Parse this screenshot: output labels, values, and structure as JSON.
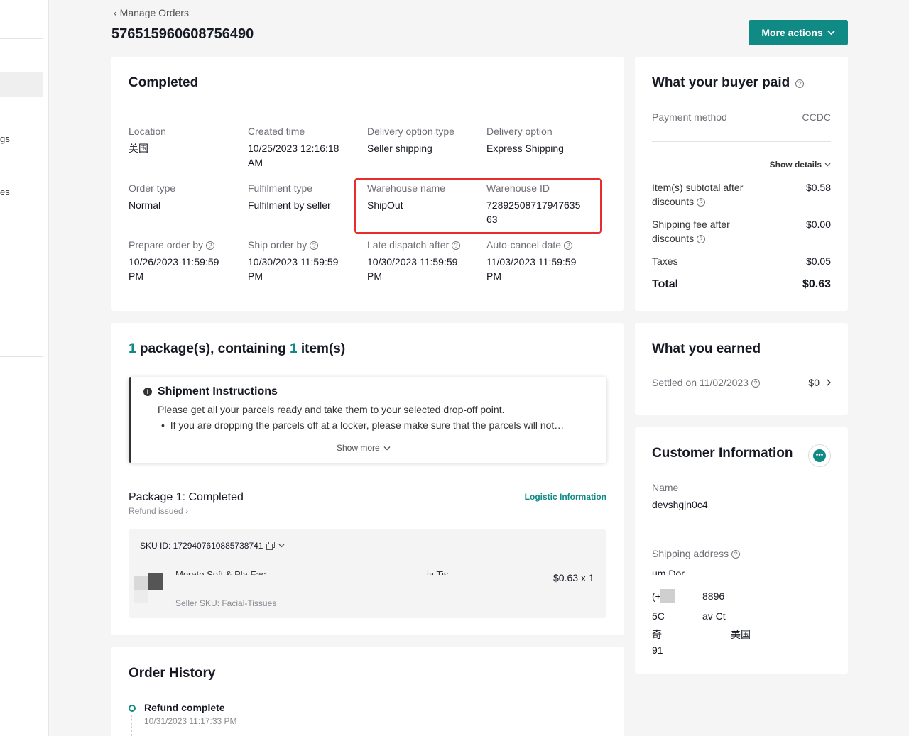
{
  "sidebar": {
    "item1": "gs",
    "item2": "es"
  },
  "header": {
    "back_label": "Manage Orders",
    "order_id": "576515960608756490",
    "more_actions": "More actions"
  },
  "status": {
    "title": "Completed",
    "fields": [
      {
        "label": "Location",
        "value": "美国"
      },
      {
        "label": "Created time",
        "value": "10/25/2023 12:16:18 AM"
      },
      {
        "label": "Delivery option type",
        "value": "Seller shipping"
      },
      {
        "label": "Delivery option",
        "value": "Express Shipping"
      },
      {
        "label": "Order type",
        "value": "Normal"
      },
      {
        "label": "Fulfilment type",
        "value": "Fulfilment by seller"
      },
      {
        "label": "Warehouse name",
        "value": "ShipOut"
      },
      {
        "label": "Warehouse ID",
        "value": "7289250871794763563"
      },
      {
        "label": "Prepare order by",
        "value": "10/26/2023 11:59:59 PM"
      },
      {
        "label": "Ship order by",
        "value": "10/30/2023 11:59:59 PM"
      },
      {
        "label": "Late dispatch after",
        "value": "10/30/2023 11:59:59 PM"
      },
      {
        "label": "Auto-cancel date",
        "value": "11/03/2023 11:59:59 PM"
      }
    ]
  },
  "packages": {
    "count": "1",
    "text1": " package(s), containing ",
    "items": "1",
    "text2": " item(s)",
    "instructions": {
      "title": "Shipment Instructions",
      "line1": "Please get all your parcels ready and take them to your selected drop-off point.",
      "line2": "If you are dropping the parcels off at a locker, please make sure that the parcels will not…",
      "show_more": "Show more"
    },
    "package_title": "Package 1: Completed",
    "refund": "Refund issued",
    "logistic": "Logistic Information",
    "sku_id": "SKU ID: 1729407610885738741",
    "product_name": "Moreto Soft & Pla Fac",
    "product_variant": "ia Tis",
    "price": "$0.63 x 1",
    "seller_sku": "Seller SKU: Facial-Tissues"
  },
  "history": {
    "title": "Order History",
    "event": "Refund complete",
    "time": "10/31/2023 11:17:33 PM"
  },
  "buyer_paid": {
    "title": "What your buyer paid",
    "payment_label": "Payment method",
    "payment_value": "CCDC",
    "show_details": "Show details",
    "subtotal_label": "Item(s) subtotal after discounts",
    "subtotal": "$0.58",
    "shipping_label": "Shipping fee after discounts",
    "shipping": "$0.00",
    "taxes_label": "Taxes",
    "taxes": "$0.05",
    "total_label": "Total",
    "total": "$0.63"
  },
  "earned": {
    "title": "What you earned",
    "settled": "Settled on 11/02/2023",
    "amount": "$0"
  },
  "customer": {
    "title": "Customer Information",
    "name_label": "Name",
    "name": "devshgjn0c4",
    "address_label": "Shipping address",
    "addr1": "um Dor",
    "addr2a": "(+",
    "addr2b": "8896",
    "addr3a": "5C",
    "addr3b": "av Ct",
    "addr4a": "奇",
    "addr4b": "美国",
    "addr5": "91"
  }
}
